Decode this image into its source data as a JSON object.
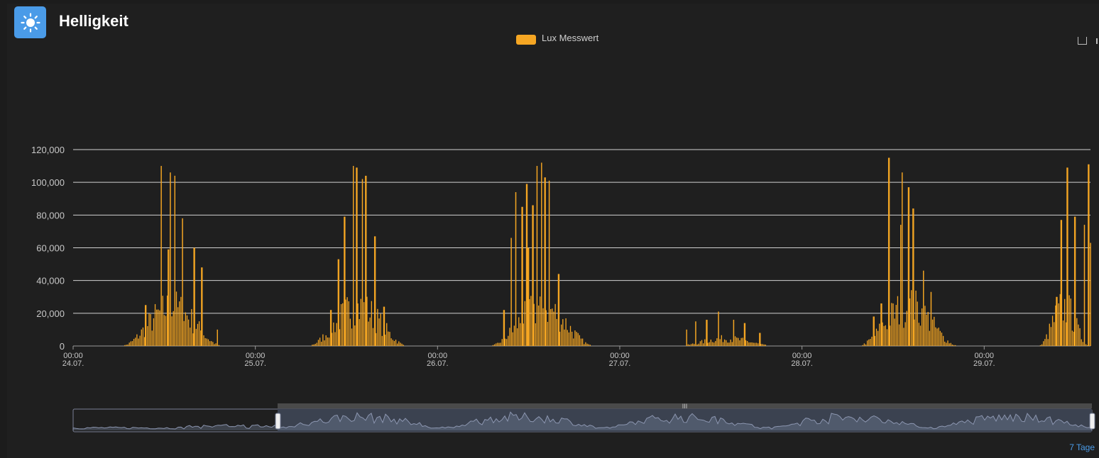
{
  "header": {
    "title": "Helligkeit",
    "icon": "sun-icon",
    "icon_color": "#4a9be8"
  },
  "legend": {
    "label": "Lux Messwert",
    "color": "#f5a623"
  },
  "navigator": {
    "range_label": "7 Tage"
  },
  "chart_data": {
    "type": "bar",
    "color": "#f5a623",
    "ylim": [
      0,
      120000
    ],
    "y_ticks": [
      0,
      20000,
      40000,
      60000,
      80000,
      100000,
      120000
    ],
    "y_tick_labels": [
      "0",
      "20,000",
      "40,000",
      "60,000",
      "80,000",
      "100,000",
      "120,000"
    ],
    "x_range_hours": [
      0,
      134
    ],
    "x_ticks": [
      {
        "hour": 0,
        "time": "00:00",
        "date": "24.07."
      },
      {
        "hour": 24,
        "time": "00:00",
        "date": "25.07."
      },
      {
        "hour": 48,
        "time": "00:00",
        "date": "26.07."
      },
      {
        "hour": 72,
        "time": "00:00",
        "date": "27.07."
      },
      {
        "hour": 96,
        "time": "00:00",
        "date": "28.07."
      },
      {
        "hour": 120,
        "time": "00:00",
        "date": "29.07."
      }
    ],
    "grid": true,
    "days": [
      {
        "start": 6.0,
        "end": 20.0,
        "peaks": [
          [
            11.6,
            110000
          ],
          [
            12.8,
            106000
          ],
          [
            13.4,
            104000
          ],
          [
            12.5,
            59000
          ],
          [
            14.4,
            78000
          ],
          [
            15.9,
            60000
          ],
          [
            16.9,
            48000
          ],
          [
            9.5,
            25000
          ],
          [
            11.0,
            22000
          ],
          [
            19.0,
            10000
          ]
        ]
      },
      {
        "start": 30.5,
        "end": 44.5,
        "peaks": [
          [
            35.8,
            79000
          ],
          [
            36.9,
            110000
          ],
          [
            37.4,
            109000
          ],
          [
            38.1,
            102000
          ],
          [
            38.6,
            104000
          ],
          [
            39.8,
            67000
          ],
          [
            35.0,
            53000
          ],
          [
            34.0,
            22000
          ],
          [
            41.0,
            24000
          ]
        ]
      },
      {
        "start": 54.5,
        "end": 69.0,
        "peaks": [
          [
            57.7,
            66000
          ],
          [
            58.3,
            94000
          ],
          [
            59.2,
            85000
          ],
          [
            59.8,
            99000
          ],
          [
            60.6,
            86000
          ],
          [
            61.1,
            110000
          ],
          [
            61.7,
            112000
          ],
          [
            62.2,
            103000
          ],
          [
            62.7,
            101000
          ],
          [
            64.0,
            44000
          ],
          [
            60.0,
            60000
          ],
          [
            56.8,
            22000
          ]
        ]
      },
      {
        "start": 79.0,
        "end": 93.0,
        "peaks": [
          [
            82.0,
            15000
          ],
          [
            83.5,
            16000
          ],
          [
            85.0,
            21000
          ],
          [
            87.0,
            16000
          ],
          [
            88.5,
            14000
          ],
          [
            80.8,
            10000
          ],
          [
            90.5,
            8000
          ]
        ]
      },
      {
        "start": 103.0,
        "end": 117.0,
        "peaks": [
          [
            107.5,
            115000
          ],
          [
            109.2,
            106000
          ],
          [
            110.1,
            97000
          ],
          [
            110.7,
            84000
          ],
          [
            109.0,
            74000
          ],
          [
            112.0,
            46000
          ],
          [
            113.0,
            33000
          ],
          [
            106.5,
            26000
          ],
          [
            105.5,
            18000
          ]
        ]
      },
      {
        "start": 127.0,
        "end": 134.0,
        "peaks": [
          [
            130.1,
            77000
          ],
          [
            130.9,
            109000
          ],
          [
            131.9,
            79000
          ],
          [
            133.2,
            74000
          ],
          [
            133.7,
            111000
          ],
          [
            134.0,
            63000
          ],
          [
            129.5,
            30000
          ]
        ]
      }
    ]
  }
}
